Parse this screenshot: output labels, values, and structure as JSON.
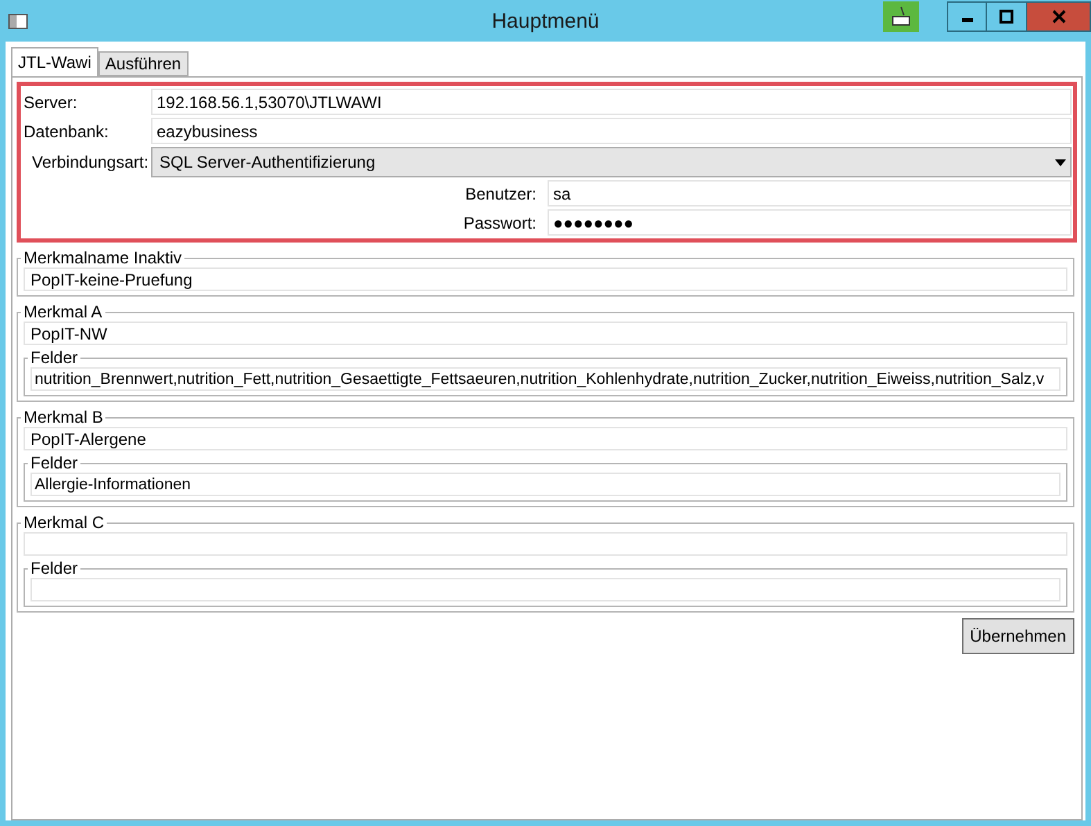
{
  "window": {
    "title": "Hauptmenü"
  },
  "tabs": [
    {
      "label": "JTL-Wawi",
      "selected": true
    },
    {
      "label": "Ausführen",
      "selected": false
    }
  ],
  "connection": {
    "server_label": "Server:",
    "server": "192.168.56.1,53070\\JTLWAWI",
    "database_label": "Datenbank:",
    "database": "eazybusiness",
    "auth_label": "Verbindungsart:",
    "auth": "SQL Server-Authentifizierung",
    "user_label": "Benutzer:",
    "user": "sa",
    "password_label": "Passwort:",
    "password": "●●●●●●●●"
  },
  "groups": [
    {
      "title": "Merkmalname Inaktiv",
      "name": "PopIT-keine-Pruefung"
    },
    {
      "title": "Merkmal A",
      "name": "PopIT-NW",
      "fields_title": "Felder",
      "fields": "nutrition_Brennwert,nutrition_Fett,nutrition_Gesaettigte_Fettsaeuren,nutrition_Kohlenhydrate,nutrition_Zucker,nutrition_Eiweiss,nutrition_Salz,v"
    },
    {
      "title": "Merkmal B",
      "name": "PopIT-Alergene",
      "fields_title": "Felder",
      "fields": "Allergie-Informationen"
    },
    {
      "title": "Merkmal C",
      "fields_title": "Felder"
    }
  ],
  "apply_button": "Übernehmen"
}
